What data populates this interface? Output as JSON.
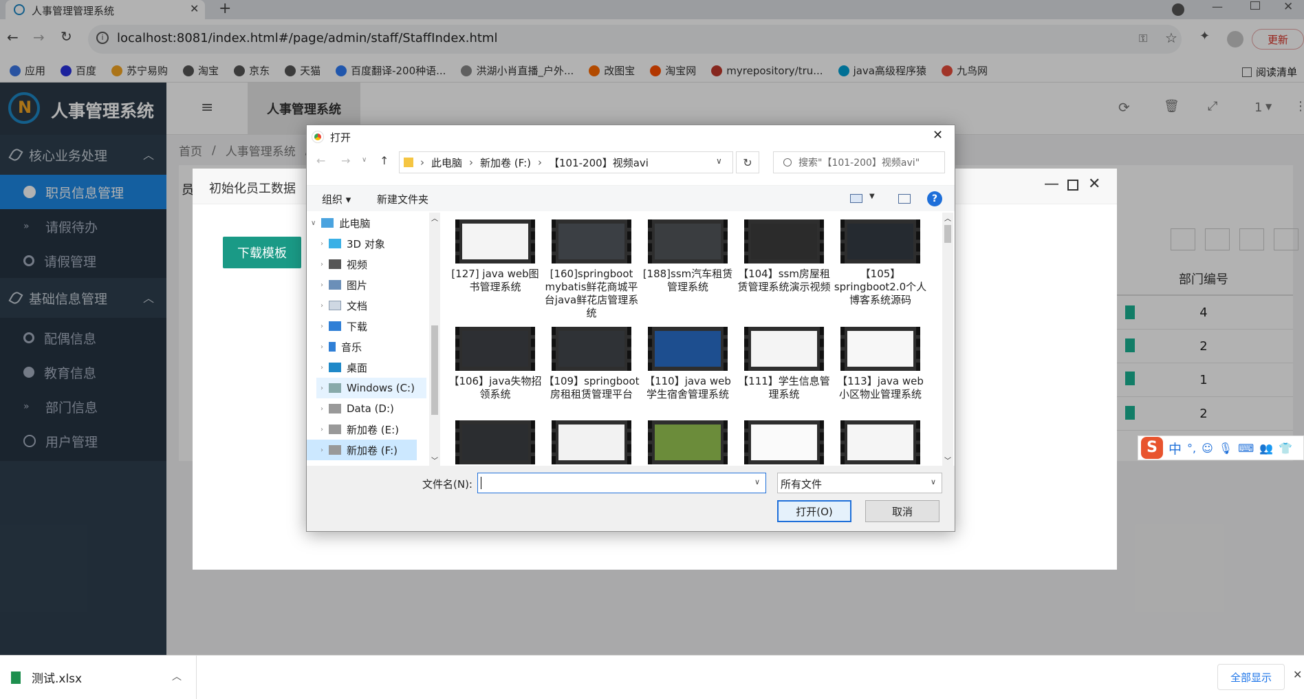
{
  "browser": {
    "tab_title": "人事管理管理系统",
    "url": "localhost:8081/index.html#/page/admin/staff/StaffIndex.html",
    "update_label": "更新",
    "bookmarks": [
      {
        "label": "应用",
        "color": "#3b78e7"
      },
      {
        "label": "百度",
        "color": "#2932e1"
      },
      {
        "label": "苏宁易购",
        "color": "#f5a623"
      },
      {
        "label": "淘宝",
        "color": "#555555"
      },
      {
        "label": "京东",
        "color": "#555555"
      },
      {
        "label": "天猫",
        "color": "#555555"
      },
      {
        "label": "百度翻译-200种语...",
        "color": "#2f7cf6"
      },
      {
        "label": "洪湖小肖直播_户外...",
        "color": "#888888"
      },
      {
        "label": "改图宝",
        "color": "#ff6a00"
      },
      {
        "label": "淘宝网",
        "color": "#ff5000"
      },
      {
        "label": "myrepository/tru...",
        "color": "#c0392b"
      },
      {
        "label": "java高级程序猿",
        "color": "#00a1d6"
      },
      {
        "label": "九鸟网",
        "color": "#e74c3c"
      }
    ],
    "reading_list": "阅读清单"
  },
  "app": {
    "title": "人事管理系统",
    "top_tab": "人事管理系统",
    "page_indicator": "1",
    "breadcrumb": [
      "首页",
      "人事管理系统",
      "/"
    ],
    "sidebar": {
      "group1": "核心业务处理",
      "items1": [
        "职员信息管理",
        "请假待办",
        "请假管理"
      ],
      "group2": "基础信息管理",
      "items2": [
        "配偶信息",
        "教育信息",
        "部门信息",
        "用户管理"
      ]
    },
    "table_header": "部门编号",
    "table_values": [
      "4",
      "2",
      "1",
      "2"
    ],
    "content_tab_first_char": "员"
  },
  "modal": {
    "title": "初始化员工数据",
    "download_button": "下载模板"
  },
  "file_dialog": {
    "title": "打开",
    "path": [
      "此电脑",
      "新加卷 (F:)",
      "【101-200】视频avi"
    ],
    "search_placeholder": "搜索\"【101-200】视频avi\"",
    "organize": "组织",
    "new_folder": "新建文件夹",
    "tree": [
      "此电脑",
      "3D 对象",
      "视频",
      "图片",
      "文档",
      "下载",
      "音乐",
      "桌面",
      "Windows (C:)",
      "Data (D:)",
      "新加卷 (E:)",
      "新加卷 (F:)"
    ],
    "files": [
      "[127] java web图书管理系统",
      "[160]springboot mybatis鲜花商城平台java鲜花店管理系统",
      "[188]ssm汽车租赁管理系统",
      "【104】ssm房屋租赁管理系统演示视频",
      "【105】springboot2.0个人博客系统源码",
      "【106】java失物招领系统",
      "【109】springboot房租租赁管理平台",
      "【110】java web学生宿舍管理系统",
      "【111】学生信息管理系统",
      "【113】java web小区物业管理系统"
    ],
    "filename_label": "文件名(N):",
    "filename_value": "",
    "filetype": "所有文件",
    "open_button": "打开(O)",
    "cancel_button": "取消"
  },
  "ime": {
    "label": "中"
  },
  "download_bar": {
    "file": "测试.xlsx",
    "show_all": "全部显示"
  }
}
